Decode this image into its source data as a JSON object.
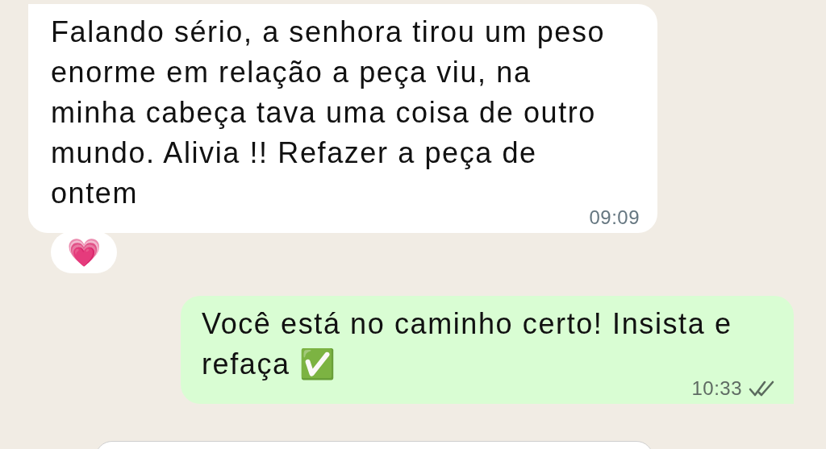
{
  "messages": [
    {
      "outgoing": false,
      "text": "Falando sério, a senhora tirou um peso enorme em relação a peça viu, na minha cabeça tava uma coisa de outro mundo. Alivia !! Refazer a peça de ontem",
      "time": "09:09",
      "reaction": "💗"
    },
    {
      "outgoing": true,
      "text": "Você está no caminho certo! Insista e refaça ✅",
      "time": "10:33",
      "read": false
    }
  ]
}
